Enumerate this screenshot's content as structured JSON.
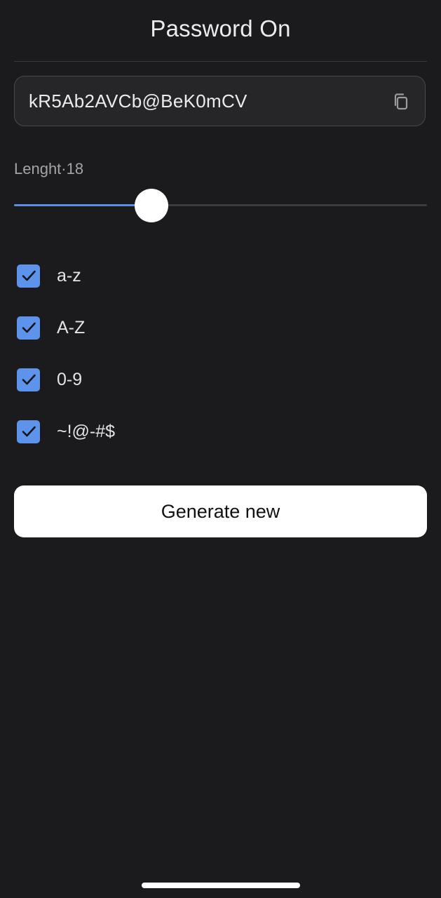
{
  "header": {
    "title": "Password On"
  },
  "password": {
    "value": "kR5Ab2AVCb@BeK0mCV",
    "copy_icon": "copy-icon"
  },
  "length": {
    "label": "Lenght·18",
    "value": 18,
    "fraction": 0.332
  },
  "options": [
    {
      "label": "a-z",
      "checked": true
    },
    {
      "label": "A-Z",
      "checked": true
    },
    {
      "label": "0-9",
      "checked": true
    },
    {
      "label": "~!@-#$",
      "checked": true
    }
  ],
  "actions": {
    "generate_label": "Generate new"
  },
  "colors": {
    "background": "#1b1b1d",
    "accent": "#5d93ea",
    "button_bg": "#ffffff",
    "button_text": "#111114"
  }
}
